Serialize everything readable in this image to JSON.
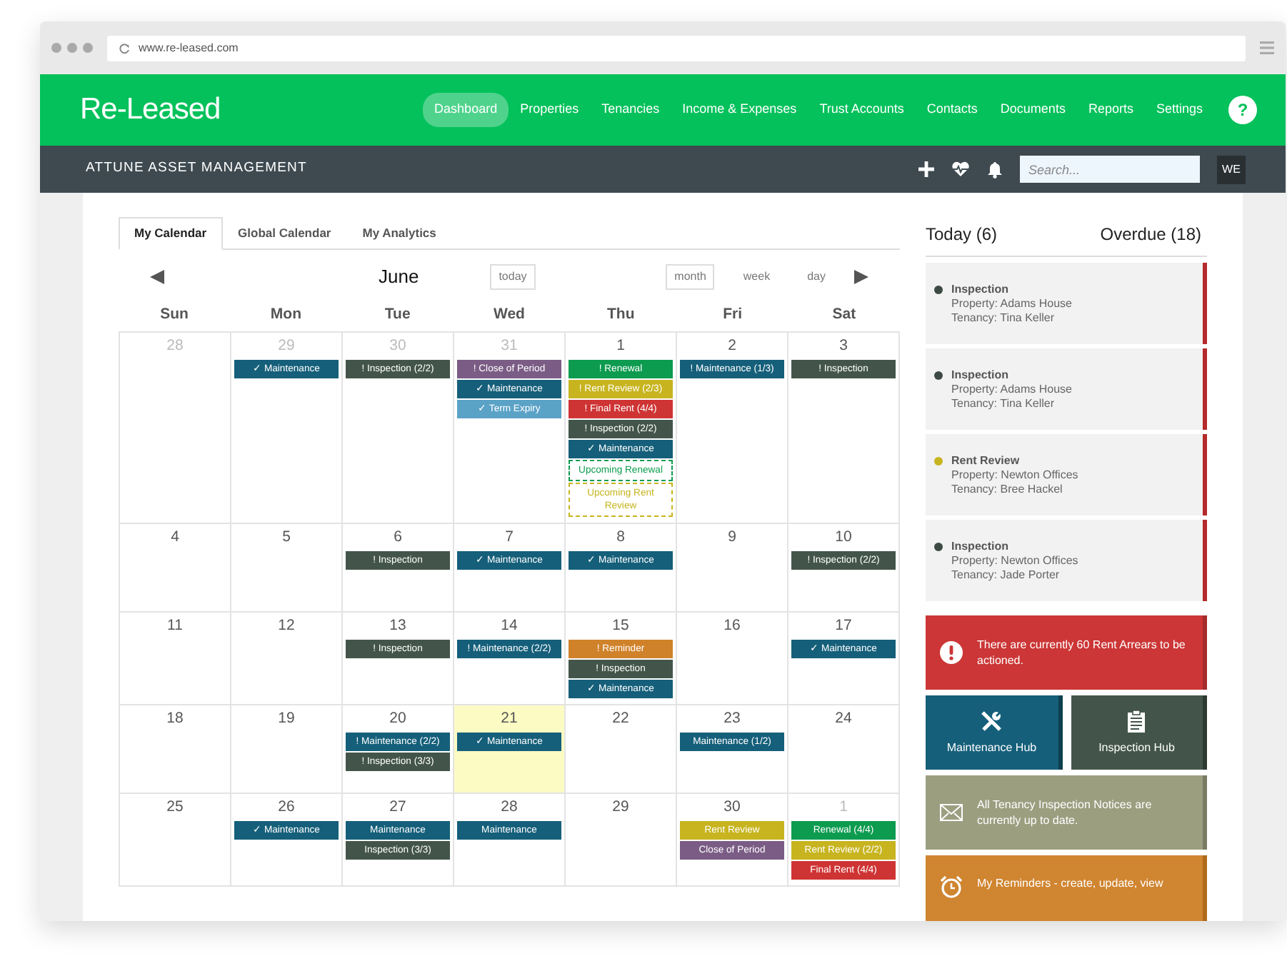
{
  "browser": {
    "url": "www.re-leased.com"
  },
  "nav": {
    "logo": "Re-Leased",
    "items": [
      {
        "label": "Dashboard",
        "selected": true
      },
      {
        "label": "Properties",
        "selected": false
      },
      {
        "label": "Tenancies",
        "selected": false
      },
      {
        "label": "Income & Expenses",
        "selected": false
      },
      {
        "label": "Trust  Accounts",
        "selected": false
      },
      {
        "label": "Contacts",
        "selected": false
      },
      {
        "label": "Documents",
        "selected": false
      },
      {
        "label": "Reports",
        "selected": false
      },
      {
        "label": "Settings",
        "selected": false
      }
    ],
    "help": "?"
  },
  "subbar": {
    "org": "ATTUNE ASSET MANAGEMENT",
    "search_placeholder": "Search...",
    "user": "WE"
  },
  "tabs": [
    {
      "label": "My Calendar",
      "selected": true
    },
    {
      "label": "Global Calendar",
      "selected": false
    },
    {
      "label": "My Analytics",
      "selected": false
    }
  ],
  "calendar": {
    "month": "June",
    "today_button": "today",
    "views": [
      {
        "label": "month",
        "selected": true
      },
      {
        "label": "week",
        "selected": false
      },
      {
        "label": "day",
        "selected": false
      }
    ],
    "weekdays": [
      "Sun",
      "Mon",
      "Tue",
      "Wed",
      "Thu",
      "Fri",
      "Sat"
    ],
    "weeks": [
      [
        {
          "day": "28",
          "muted": true,
          "today": false
        },
        {
          "day": "29",
          "muted": true,
          "today": false,
          "events": [
            {
              "text": "✓ Maintenance",
              "kind": "bar",
              "color": "#155f7a"
            }
          ]
        },
        {
          "day": "30",
          "muted": true,
          "today": false,
          "events": [
            {
              "text": "! Inspection (2/2)",
              "kind": "bar",
              "color": "#43554a"
            }
          ]
        },
        {
          "day": "31",
          "muted": true,
          "today": false,
          "events": [
            {
              "text": "! Close of Period",
              "kind": "bar",
              "color": "#7a5c85"
            },
            {
              "text": "✓ Maintenance",
              "kind": "bar",
              "color": "#155f7a"
            },
            {
              "text": "✓ Term Expiry",
              "kind": "bar",
              "color": "#5ba2c7"
            }
          ]
        },
        {
          "day": "1",
          "muted": false,
          "today": false,
          "events": [
            {
              "text": "! Renewal",
              "kind": "bar",
              "color": "#0d9b4f"
            },
            {
              "text": "! Rent Review (2/3)",
              "kind": "bar",
              "color": "#c7b41f"
            },
            {
              "text": "! Final Rent (4/4)",
              "kind": "bar",
              "color": "#cf3434"
            },
            {
              "text": "! Inspection (2/2)",
              "kind": "bar",
              "color": "#43554a"
            },
            {
              "text": "✓ Maintenance",
              "kind": "bar",
              "color": "#155f7a"
            },
            {
              "text": "Upcoming Renewal",
              "kind": "upcoming",
              "color": "#0d9b4f"
            },
            {
              "text": "Upcoming Rent Review",
              "kind": "upcoming",
              "color": "#c7b41f"
            }
          ]
        },
        {
          "day": "2",
          "muted": false,
          "today": false,
          "events": [
            {
              "text": "! Maintenance (1/3)",
              "kind": "bar",
              "color": "#155f7a"
            }
          ]
        },
        {
          "day": "3",
          "muted": false,
          "today": false,
          "events": [
            {
              "text": "! Inspection",
              "kind": "bar",
              "color": "#43554a"
            }
          ]
        }
      ],
      [
        {
          "day": "4",
          "muted": false,
          "today": false
        },
        {
          "day": "5",
          "muted": false,
          "today": false
        },
        {
          "day": "6",
          "muted": false,
          "today": false,
          "events": [
            {
              "text": "! Inspection",
              "kind": "bar",
              "color": "#43554a"
            }
          ]
        },
        {
          "day": "7",
          "muted": false,
          "today": false,
          "events": [
            {
              "text": "✓ Maintenance",
              "kind": "bar",
              "color": "#155f7a"
            }
          ]
        },
        {
          "day": "8",
          "muted": false,
          "today": false,
          "events": [
            {
              "text": "✓ Maintenance",
              "kind": "bar",
              "color": "#155f7a"
            }
          ]
        },
        {
          "day": "9",
          "muted": false,
          "today": false
        },
        {
          "day": "10",
          "muted": false,
          "today": false,
          "events": [
            {
              "text": "! Inspection (2/2)",
              "kind": "bar",
              "color": "#43554a"
            }
          ]
        }
      ],
      [
        {
          "day": "11",
          "muted": false,
          "today": false
        },
        {
          "day": "12",
          "muted": false,
          "today": false
        },
        {
          "day": "13",
          "muted": false,
          "today": false,
          "events": [
            {
              "text": "! Inspection",
              "kind": "bar",
              "color": "#43554a"
            }
          ]
        },
        {
          "day": "14",
          "muted": false,
          "today": false,
          "events": [
            {
              "text": "! Maintenance (2/2)",
              "kind": "bar",
              "color": "#155f7a"
            }
          ]
        },
        {
          "day": "15",
          "muted": false,
          "today": false,
          "events": [
            {
              "text": "! Reminder",
              "kind": "bar",
              "color": "#d0822a"
            },
            {
              "text": "! Inspection",
              "kind": "bar",
              "color": "#43554a"
            },
            {
              "text": "✓ Maintenance",
              "kind": "bar",
              "color": "#155f7a"
            }
          ]
        },
        {
          "day": "16",
          "muted": false,
          "today": false
        },
        {
          "day": "17",
          "muted": false,
          "today": false,
          "events": [
            {
              "text": "✓ Maintenance",
              "kind": "bar",
              "color": "#155f7a"
            }
          ]
        }
      ],
      [
        {
          "day": "18",
          "muted": false,
          "today": false
        },
        {
          "day": "19",
          "muted": false,
          "today": false
        },
        {
          "day": "20",
          "muted": false,
          "today": false,
          "events": [
            {
              "text": "! Maintenance (2/2)",
              "kind": "bar",
              "color": "#155f7a"
            },
            {
              "text": "! Inspection (3/3)",
              "kind": "bar",
              "color": "#43554a"
            }
          ]
        },
        {
          "day": "21",
          "muted": false,
          "today": true,
          "events": [
            {
              "text": "✓ Maintenance",
              "kind": "bar",
              "color": "#155f7a"
            }
          ]
        },
        {
          "day": "22",
          "muted": false,
          "today": false
        },
        {
          "day": "23",
          "muted": false,
          "today": false,
          "events": [
            {
              "text": "Maintenance (1/2)",
              "kind": "bar",
              "color": "#155f7a"
            }
          ]
        },
        {
          "day": "24",
          "muted": false,
          "today": false
        }
      ],
      [
        {
          "day": "25",
          "muted": false,
          "today": false
        },
        {
          "day": "26",
          "muted": false,
          "today": false,
          "events": [
            {
              "text": "✓ Maintenance",
              "kind": "bar",
              "color": "#155f7a"
            }
          ]
        },
        {
          "day": "27",
          "muted": false,
          "today": false,
          "events": [
            {
              "text": "Maintenance",
              "kind": "bar",
              "color": "#155f7a"
            },
            {
              "text": "Inspection (3/3)",
              "kind": "bar",
              "color": "#43554a"
            }
          ]
        },
        {
          "day": "28",
          "muted": false,
          "today": false,
          "events": [
            {
              "text": "Maintenance",
              "kind": "bar",
              "color": "#155f7a"
            }
          ]
        },
        {
          "day": "29",
          "muted": false,
          "today": false
        },
        {
          "day": "30",
          "muted": false,
          "today": false,
          "events": [
            {
              "text": "Rent Review",
              "kind": "bar",
              "color": "#c7b41f"
            },
            {
              "text": "Close of Period",
              "kind": "bar",
              "color": "#7a5c85"
            }
          ]
        },
        {
          "day": "1",
          "muted": true,
          "today": false,
          "events": [
            {
              "text": "Renewal (4/4)",
              "kind": "bar",
              "color": "#0d9b4f"
            },
            {
              "text": "Rent Review (2/2)",
              "kind": "bar",
              "color": "#c7b41f"
            },
            {
              "text": "Final Rent (4/4)",
              "kind": "bar",
              "color": "#cf3434"
            }
          ]
        }
      ]
    ]
  },
  "side": {
    "tabs": [
      {
        "label": "Today (6)"
      },
      {
        "label": "Overdue (18)"
      }
    ],
    "tasks": [
      {
        "title": "Inspection",
        "property": "Property: Adams House",
        "tenancy": "Tenancy: Tina Keller",
        "color": "#3d4a44"
      },
      {
        "title": "Inspection",
        "property": "Property: Adams House",
        "tenancy": "Tenancy: Tina Keller",
        "color": "#3d4a44"
      },
      {
        "title": "Rent Review",
        "property": "Property: Newton Offices",
        "tenancy": "Tenancy: Bree Hackel",
        "color": "#c7b41f"
      },
      {
        "title": "Inspection",
        "property": "Property: Newton Offices",
        "tenancy": "Tenancy: Jade Porter",
        "color": "#3d4a44"
      }
    ],
    "arrears": "There are currently 60 Rent Arrears to be actioned.",
    "hubs": [
      {
        "label": "Maintenance Hub",
        "kind": "tools"
      },
      {
        "label": "Inspection Hub",
        "kind": "clipboard"
      }
    ],
    "notice": "All Tenancy Inspection Notices are currently up to date.",
    "reminders": "My Reminders - create, update, view"
  }
}
